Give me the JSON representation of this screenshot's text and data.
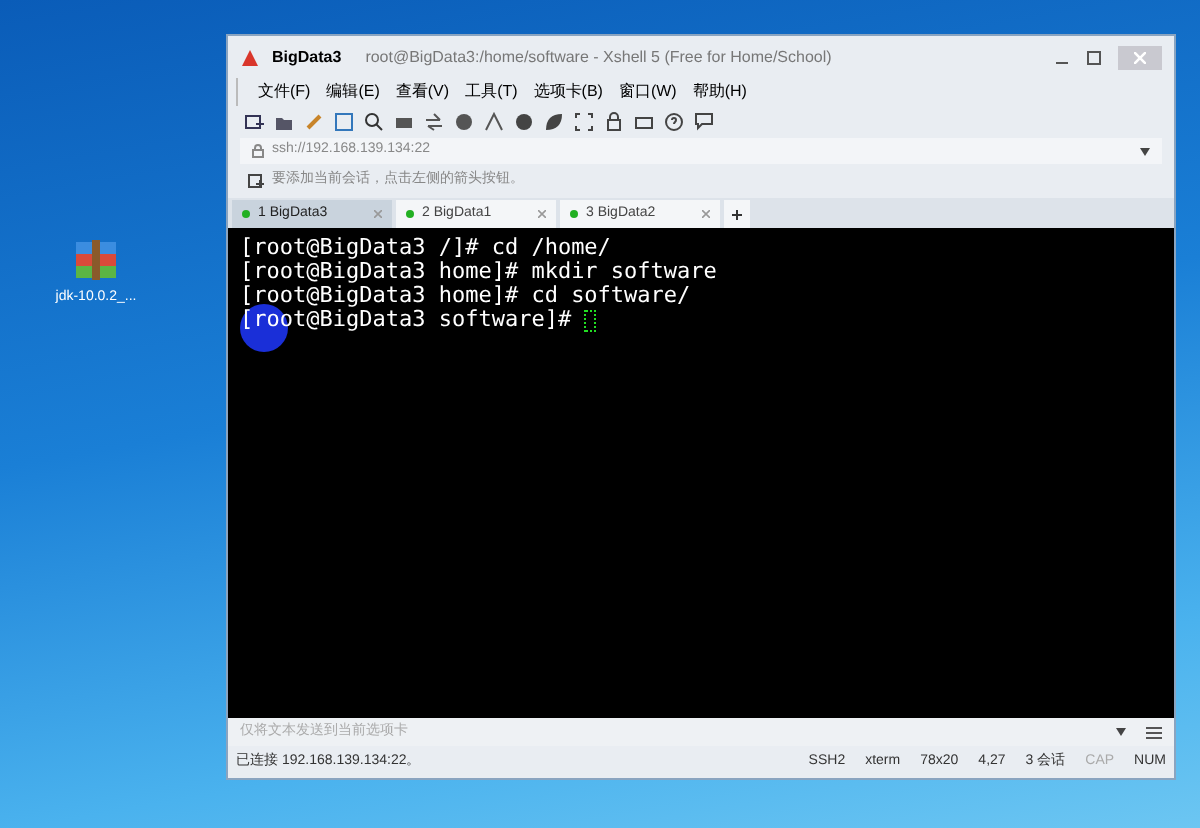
{
  "desktop": {
    "icons": [
      {
        "label": "jdk-10.0.2_..."
      }
    ]
  },
  "window": {
    "app_name": "BigData3",
    "title": "root@BigData3:/home/software - Xshell 5 (Free for Home/School)"
  },
  "menu": [
    "文件(F)",
    "编辑(E)",
    "查看(V)",
    "工具(T)",
    "选项卡(B)",
    "窗口(W)",
    "帮助(H)"
  ],
  "address": {
    "value": "ssh://192.168.139.134:22"
  },
  "hint": "要添加当前会话，点击左侧的箭头按钮。",
  "tabs": [
    {
      "label": "1 BigData3",
      "selected": true
    },
    {
      "label": "2 BigData1",
      "selected": false
    },
    {
      "label": "3 BigData2",
      "selected": false
    }
  ],
  "terminal": {
    "lines": [
      "[root@BigData3 /]# cd /home/",
      "[root@BigData3 home]# mkdir software",
      "[root@BigData3 home]# cd software/",
      "[root@BigData3 software]# "
    ]
  },
  "send_bar": {
    "placeholder": "仅将文本发送到当前选项卡"
  },
  "status_bar": {
    "connection": "已连接 192.168.139.134:22。",
    "protocol": "SSH2",
    "terminal_type": "xterm",
    "size": "78x20",
    "cursor": "4,27",
    "sessions": "3 会话",
    "caps": "CAP",
    "num": "NUM"
  }
}
